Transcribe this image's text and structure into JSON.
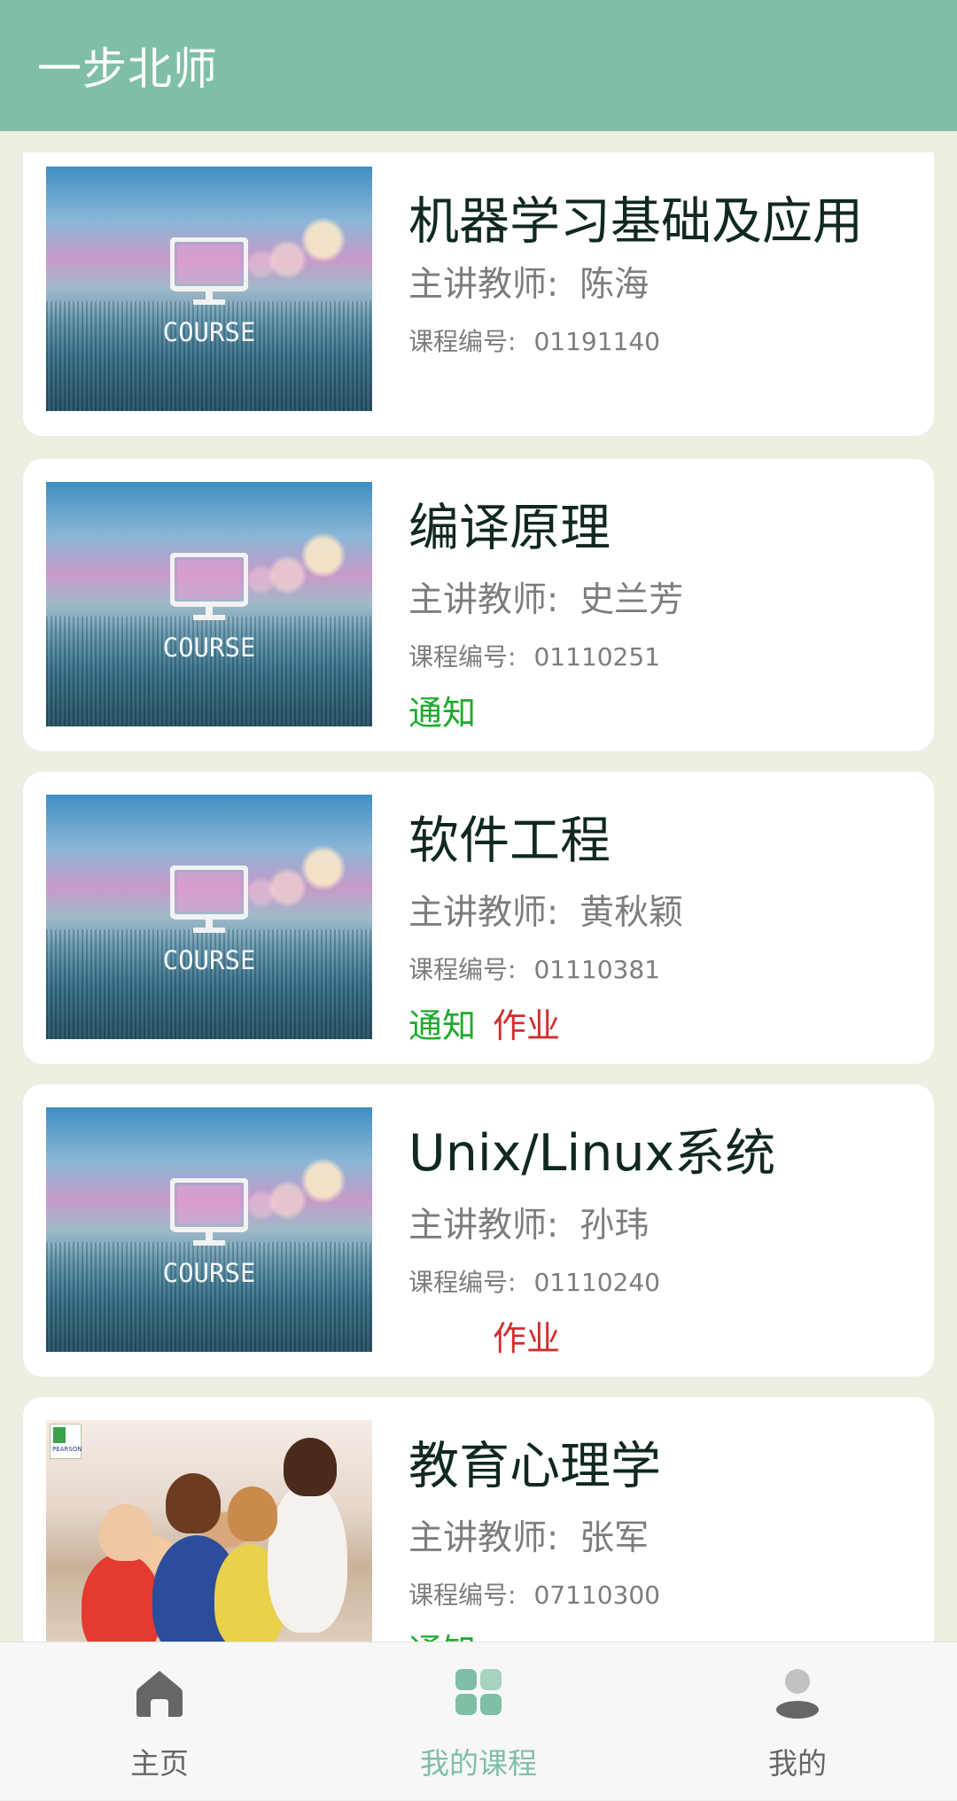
{
  "app": {
    "title": "一步北师"
  },
  "labels": {
    "teacher_prefix": "主讲教师:",
    "code_prefix": "课程编号:",
    "notice": "通知",
    "homework": "作业",
    "thumb_text": "COURSE"
  },
  "courses": [
    {
      "title": "机器学习基础及应用",
      "teacher": "陈海",
      "code": "01191140",
      "thumbnail": "course-default",
      "has_notice": false,
      "has_homework": false
    },
    {
      "title": "编译原理",
      "teacher": "史兰芳",
      "code": "01110251",
      "thumbnail": "course-default",
      "has_notice": true,
      "has_homework": false
    },
    {
      "title": "软件工程",
      "teacher": "黄秋颖",
      "code": "01110381",
      "thumbnail": "course-default",
      "has_notice": true,
      "has_homework": true
    },
    {
      "title": "Unix/Linux系统",
      "teacher": "孙玮",
      "code": "01110240",
      "thumbnail": "course-default",
      "has_notice": false,
      "has_homework": true
    },
    {
      "title": "教育心理学",
      "teacher": "张军",
      "code": "07110300",
      "thumbnail": "classroom-photo",
      "has_notice": true,
      "has_homework": false
    }
  ],
  "bottom_nav": {
    "items": [
      {
        "label": "主页",
        "icon": "home-icon",
        "active": false
      },
      {
        "label": "我的课程",
        "icon": "grid-icon",
        "active": true
      },
      {
        "label": "我的",
        "icon": "person-icon",
        "active": false
      }
    ]
  },
  "colors": {
    "app_bar": "#7fbfa6",
    "background": "#ecefe2",
    "notice": "#1eaa2b",
    "homework": "#d22d2d",
    "nav_active": "#7fbfa6",
    "nav_inactive": "#666666"
  }
}
